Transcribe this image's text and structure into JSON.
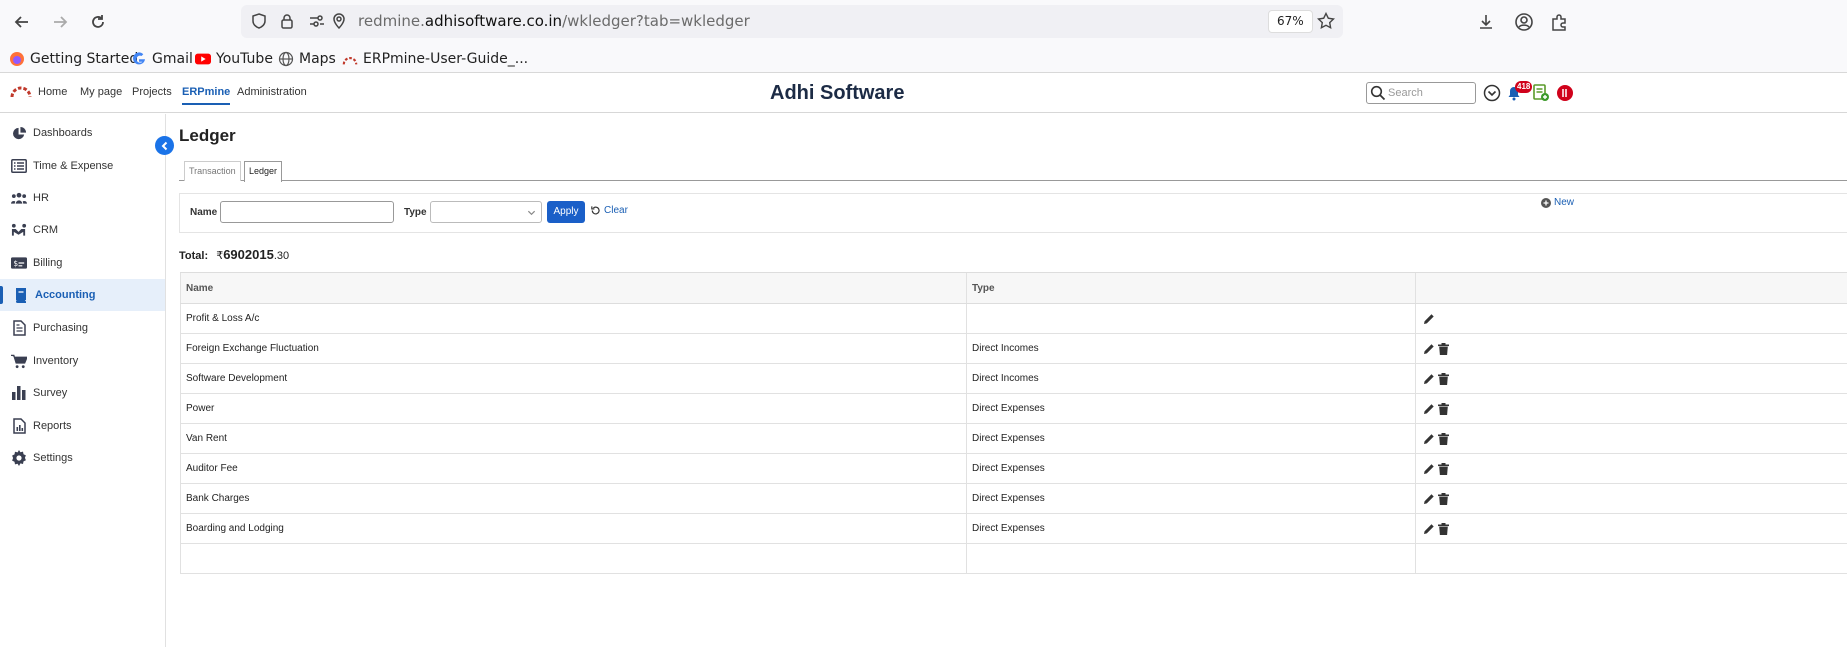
{
  "browser": {
    "url_prefix": "redmine.",
    "url_host": "adhisoftware.co.in",
    "url_path": "/wkledger?tab=wkledger",
    "zoom": "67%",
    "bookmarks": [
      {
        "label": "Getting Started",
        "icon": "firefox-icon"
      },
      {
        "label": "Gmail",
        "icon": "google-icon"
      },
      {
        "label": "YouTube",
        "icon": "youtube-icon"
      },
      {
        "label": "Maps",
        "icon": "globe-icon"
      },
      {
        "label": "ERPmine-User-Guide_...",
        "icon": "erpmine-icon"
      }
    ]
  },
  "topnav": {
    "links": [
      "Home",
      "My page",
      "Projects",
      "ERPmine",
      "Administration"
    ],
    "active": "ERPmine",
    "app_title": "Adhi Software",
    "search_placeholder": "Search",
    "notification_count": "418"
  },
  "sidebar": {
    "items": [
      {
        "label": "Dashboards",
        "icon": "pie-chart-icon"
      },
      {
        "label": "Time & Expense",
        "icon": "list-icon"
      },
      {
        "label": "HR",
        "icon": "users-icon"
      },
      {
        "label": "CRM",
        "icon": "handshake-icon"
      },
      {
        "label": "Billing",
        "icon": "money-bill-icon"
      },
      {
        "label": "Accounting",
        "icon": "book-icon"
      },
      {
        "label": "Purchasing",
        "icon": "document-icon"
      },
      {
        "label": "Inventory",
        "icon": "cart-icon"
      },
      {
        "label": "Survey",
        "icon": "bar-chart-icon"
      },
      {
        "label": "Reports",
        "icon": "report-icon"
      },
      {
        "label": "Settings",
        "icon": "gear-icon"
      }
    ],
    "active": "Accounting"
  },
  "page": {
    "heading": "Ledger",
    "tabs": [
      {
        "label": "Transaction",
        "active": false
      },
      {
        "label": "Ledger",
        "active": true
      }
    ]
  },
  "filters": {
    "name_label": "Name",
    "name_value": "",
    "type_label": "Type",
    "type_value": "",
    "apply_label": "Apply",
    "clear_label": "Clear",
    "new_label": "New"
  },
  "total": {
    "label": "Total:",
    "currency": "₹",
    "amount_int": "6902015",
    "amount_dec": ".30"
  },
  "table": {
    "columns": [
      "Name",
      "Type",
      ""
    ],
    "rows": [
      {
        "name": "Profit & Loss A/c",
        "type": "",
        "can_delete": false
      },
      {
        "name": "Foreign Exchange Fluctuation",
        "type": "Direct Incomes",
        "can_delete": true
      },
      {
        "name": "Software Development",
        "type": "Direct Incomes",
        "can_delete": true
      },
      {
        "name": "Power",
        "type": "Direct Expenses",
        "can_delete": true
      },
      {
        "name": "Van Rent",
        "type": "Direct Expenses",
        "can_delete": true
      },
      {
        "name": "Auditor Fee",
        "type": "Direct Expenses",
        "can_delete": true
      },
      {
        "name": "Bank Charges",
        "type": "Direct Expenses",
        "can_delete": true
      },
      {
        "name": "Boarding and Lodging",
        "type": "Direct Expenses",
        "can_delete": true
      },
      {
        "name": "",
        "type": "",
        "can_delete": false
      }
    ]
  },
  "colors": {
    "accent": "#1a5fb4",
    "apply_button": "#1a5fc8",
    "notification_badge": "#d0021b"
  }
}
